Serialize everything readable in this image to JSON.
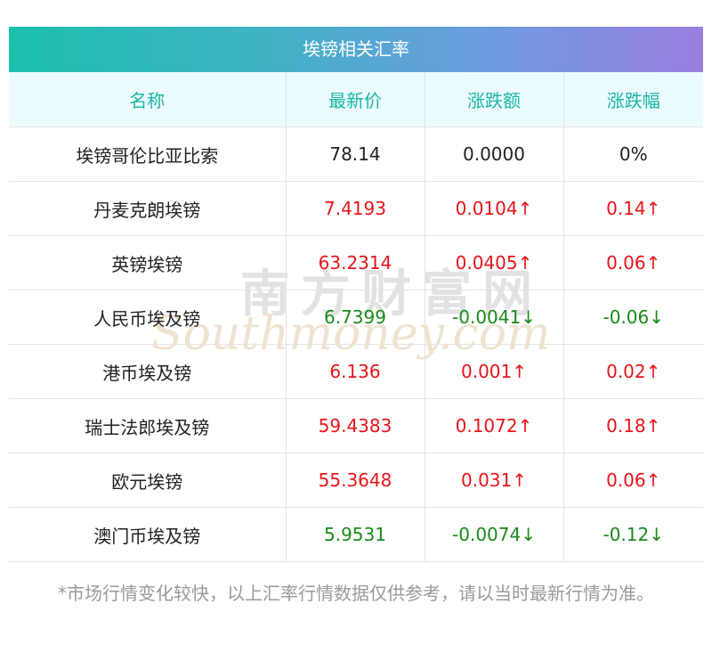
{
  "title": "埃镑相关汇率",
  "headers": [
    "名称",
    "最新价",
    "涨跌额",
    "涨跌幅"
  ],
  "rows": [
    {
      "name": "埃镑哥伦比亚比索",
      "price": "78.14",
      "change": "0.0000",
      "pct": "0%",
      "trend": "flat"
    },
    {
      "name": "丹麦克朗埃镑",
      "price": "7.4193",
      "change": "0.0104↑",
      "pct": "0.14↑",
      "trend": "up"
    },
    {
      "name": "英镑埃镑",
      "price": "63.2314",
      "change": "0.0405↑",
      "pct": "0.06↑",
      "trend": "up"
    },
    {
      "name": "人民币埃及镑",
      "price": "6.7399",
      "change": "-0.0041↓",
      "pct": "-0.06↓",
      "trend": "down"
    },
    {
      "name": "港币埃及镑",
      "price": "6.136",
      "change": "0.001↑",
      "pct": "0.02↑",
      "trend": "up"
    },
    {
      "name": "瑞士法郎埃及镑",
      "price": "59.4383",
      "change": "0.1072↑",
      "pct": "0.18↑",
      "trend": "up"
    },
    {
      "name": "欧元埃镑",
      "price": "55.3648",
      "change": "0.031↑",
      "pct": "0.06↑",
      "trend": "up"
    },
    {
      "name": "澳门币埃及镑",
      "price": "5.9531",
      "change": "-0.0074↓",
      "pct": "-0.12↓",
      "trend": "down"
    }
  ],
  "watermark": {
    "cn": "南方财富网",
    "en": "Southmoney.com"
  },
  "note": "*市场行情变化较快，以上汇率行情数据仅供参考，请以当时最新行情为准。",
  "colors": {
    "up": "#e8141a",
    "down": "#1a8a1a",
    "header_text": "#1bb6a8"
  }
}
